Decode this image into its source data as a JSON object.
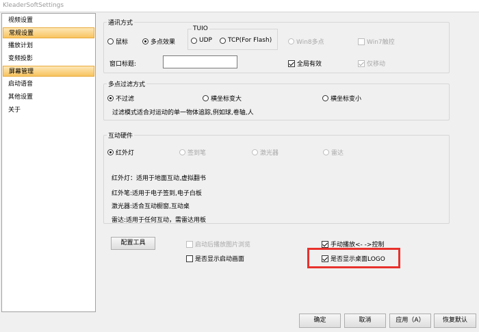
{
  "window": {
    "title": "KleaderSoftSettings"
  },
  "sidebar": {
    "items": [
      {
        "label": "视频设置",
        "selected": false
      },
      {
        "label": "常规设置",
        "selected": true
      },
      {
        "label": "播放计划",
        "selected": false
      },
      {
        "label": "变频投影",
        "selected": false
      },
      {
        "label": "屏幕管理",
        "selected": true
      },
      {
        "label": "启动语音",
        "selected": false
      },
      {
        "label": "其他设置",
        "selected": false
      },
      {
        "label": "关于",
        "selected": false
      }
    ]
  },
  "comm": {
    "title": "通讯方式",
    "mouse_label": "鼠标",
    "multitouch_label": "多点效果",
    "tuio_title": "TUIO",
    "udp_label": "UDP",
    "tcp_label": "TCP(For Flash)",
    "win8_label": "Win8多点",
    "win7_label": "Win7触控",
    "window_title_label": "窗口标题:",
    "window_title_value": "",
    "global_label": "全局有效",
    "move_only_label": "仅移动"
  },
  "filter": {
    "title": "多点过滤方式",
    "none_label": "不过滤",
    "h_label": "横坐标变大",
    "v_label": "横坐标变小",
    "description": "过滤模式适合对运动的单一物体追踪,例如球,卷轴,人"
  },
  "hardware": {
    "title": "互动硬件",
    "ir_label": "红外灯",
    "pen_label": "签到笔",
    "laser_label": "激光器",
    "radar_label": "雷达",
    "desc_ir": "红外灯：适用于地面互动,虚拟翻书",
    "desc_pen": "红外笔:适用于电子签到,电子白板",
    "desc_laser": "激光器:适合互动橱窗,互动桌",
    "desc_radar": "雷达:适用于任何互动，需雷达用板"
  },
  "options": {
    "config_tool_label": "配置工具",
    "browse_after_start_label": "启动后播放图片浏览",
    "manual_play_label": "手动播放<- ->控制",
    "show_start_screen_label": "是否显示启动画面",
    "show_desktop_logo_label": "是否显示桌面LOGO"
  },
  "footer": {
    "ok_label": "确定",
    "cancel_label": "取消",
    "apply_label": "应用（A）",
    "restore_label": "恢复默认"
  },
  "colors": {
    "highlight": "#e8312c",
    "selection": "#f8c35f"
  }
}
